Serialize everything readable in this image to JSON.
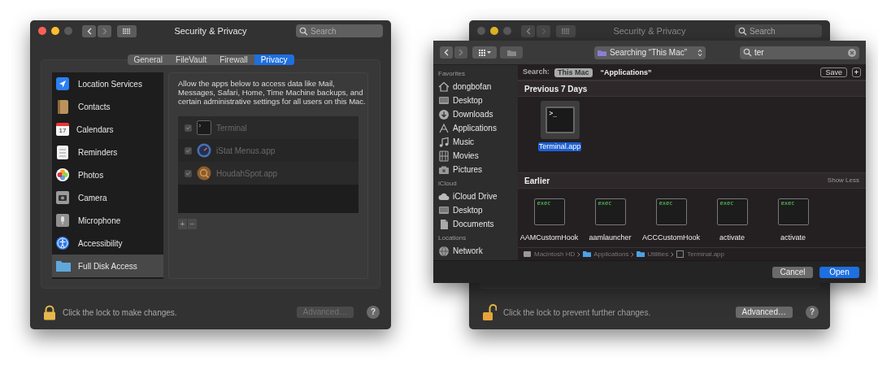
{
  "windows": [
    {
      "title": "Security & Privacy",
      "active": true,
      "search": {
        "placeholder": "Search"
      },
      "tabs": [
        {
          "label": "General",
          "selected": false
        },
        {
          "label": "FileVault",
          "selected": false
        },
        {
          "label": "Firewall",
          "selected": false
        },
        {
          "label": "Privacy",
          "selected": true
        }
      ],
      "categories": [
        {
          "label": "Location Services",
          "kind": "location",
          "selected": false
        },
        {
          "label": "Contacts",
          "kind": "contacts",
          "selected": false
        },
        {
          "label": "Calendars",
          "kind": "calendar",
          "icon_text": "17",
          "selected": false
        },
        {
          "label": "Reminders",
          "kind": "reminders",
          "selected": false
        },
        {
          "label": "Photos",
          "kind": "photos",
          "selected": false
        },
        {
          "label": "Camera",
          "kind": "camera",
          "selected": false
        },
        {
          "label": "Microphone",
          "kind": "microphone",
          "selected": false
        },
        {
          "label": "Accessibility",
          "kind": "accessibility",
          "selected": false
        },
        {
          "label": "Full Disk Access",
          "kind": "folder",
          "selected": true
        }
      ],
      "description": "Allow the apps below to access data like Mail, Messages, Safari, Home, Time Machine backups, and certain administrative settings for all users on this Mac.",
      "apps": {
        "disabled": true,
        "items": [
          {
            "name": "Terminal",
            "kind": "terminal",
            "checked": true
          },
          {
            "name": "iStat Menus.app",
            "kind": "gauge",
            "checked": true
          },
          {
            "name": "HoudahSpot.app",
            "kind": "magnifier",
            "checked": true
          }
        ]
      },
      "add_button": "+",
      "remove_button": "−",
      "lock": {
        "locked": true,
        "text": "Click the lock to make changes."
      },
      "advanced_button": {
        "label": "Advanced…",
        "disabled": true
      },
      "help_button": "?"
    },
    {
      "title": "Security & Privacy",
      "active": false,
      "search": {
        "placeholder": "Search"
      },
      "lock": {
        "locked": false,
        "text": "Click the lock to prevent further changes."
      },
      "advanced_button": {
        "label": "Advanced…",
        "disabled": false
      },
      "help_button": "?"
    }
  ],
  "open_dialog": {
    "location": "Searching “This Mac”",
    "search_value": "ter",
    "sidebar": [
      {
        "heading": "Favorites",
        "items": [
          {
            "label": "dongbofan",
            "kind": "home"
          },
          {
            "label": "Desktop",
            "kind": "desktop"
          },
          {
            "label": "Downloads",
            "kind": "downloads"
          },
          {
            "label": "Applications",
            "kind": "applications"
          },
          {
            "label": "Music",
            "kind": "music"
          },
          {
            "label": "Movies",
            "kind": "movies"
          },
          {
            "label": "Pictures",
            "kind": "pictures"
          }
        ]
      },
      {
        "heading": "iCloud",
        "items": [
          {
            "label": "iCloud Drive",
            "kind": "cloud"
          },
          {
            "label": "Desktop",
            "kind": "desktop"
          },
          {
            "label": "Documents",
            "kind": "documents"
          }
        ]
      },
      {
        "heading": "Locations",
        "items": [
          {
            "label": "Network",
            "kind": "network"
          }
        ]
      }
    ],
    "scope_label": "Search:",
    "scopes": [
      {
        "label": "This Mac",
        "selected": true
      },
      {
        "label": "“Applications”",
        "selected": false
      }
    ],
    "save_button": "Save",
    "add_button": "+",
    "groups": [
      {
        "title": "Previous 7 Days",
        "files": [
          {
            "name": "Terminal.app",
            "kind": "app",
            "badge": ">_",
            "selected": true
          }
        ]
      },
      {
        "title": "Earlier",
        "action": "Show Less",
        "files": [
          {
            "name": "AAMCustomHook",
            "kind": "exec",
            "badge": "exec",
            "selected": false
          },
          {
            "name": "aamlauncher",
            "kind": "exec",
            "badge": "exec",
            "selected": false
          },
          {
            "name": "ACCCustomHook",
            "kind": "exec",
            "badge": "exec",
            "selected": false
          },
          {
            "name": "activate",
            "kind": "exec",
            "badge": "exec",
            "selected": false
          },
          {
            "name": "activate",
            "kind": "exec",
            "badge": "exec",
            "selected": false
          }
        ]
      }
    ],
    "path": [
      {
        "label": "Macintosh HD",
        "kind": "disk"
      },
      {
        "label": "Applications",
        "kind": "folder"
      },
      {
        "label": "Utilities",
        "kind": "folder"
      },
      {
        "label": "Terminal.app",
        "kind": "app"
      }
    ],
    "cancel_button": "Cancel",
    "open_button": "Open"
  }
}
